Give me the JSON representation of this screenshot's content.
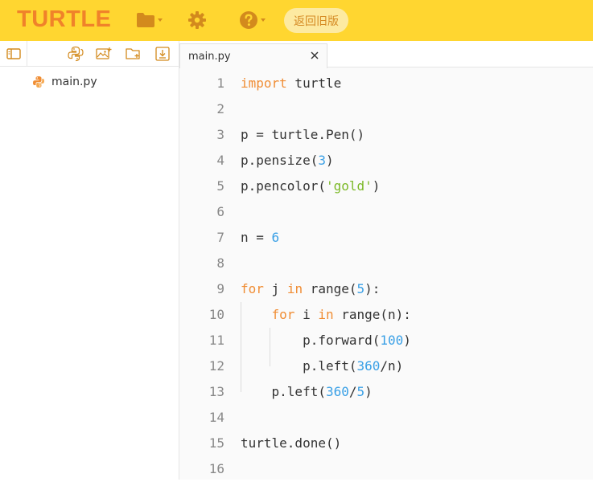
{
  "header": {
    "brand": "TURTLE",
    "old_version_label": "返回旧版"
  },
  "colors": {
    "topbar": "#ffd630",
    "brand": "#f0822a",
    "icon": "#d38a1d",
    "keyword": "#f08d34",
    "number": "#3aa0e6",
    "string": "#7cb928"
  },
  "sidebar": {
    "files": [
      {
        "name": "main.py",
        "icon": "python-file-icon"
      }
    ]
  },
  "editor": {
    "tab": {
      "label": "main.py"
    },
    "lines": [
      {
        "n": "1",
        "t": [
          [
            "kw",
            "import"
          ],
          [
            "p",
            " turtle"
          ]
        ]
      },
      {
        "n": "2",
        "t": []
      },
      {
        "n": "3",
        "t": [
          [
            "p",
            "p = turtle.Pen()"
          ]
        ]
      },
      {
        "n": "4",
        "t": [
          [
            "p",
            "p.pensize("
          ],
          [
            "num",
            "3"
          ],
          [
            "p",
            ")"
          ]
        ]
      },
      {
        "n": "5",
        "t": [
          [
            "p",
            "p.pencolor("
          ],
          [
            "str",
            "'gold'"
          ],
          [
            "p",
            ")"
          ]
        ]
      },
      {
        "n": "6",
        "t": []
      },
      {
        "n": "7",
        "t": [
          [
            "p",
            "n = "
          ],
          [
            "num",
            "6"
          ]
        ]
      },
      {
        "n": "8",
        "t": []
      },
      {
        "n": "9",
        "t": [
          [
            "kw",
            "for"
          ],
          [
            "p",
            " j "
          ],
          [
            "kw",
            "in"
          ],
          [
            "p",
            " range("
          ],
          [
            "num",
            "5"
          ],
          [
            "p",
            "):"
          ]
        ]
      },
      {
        "n": "10",
        "t": [
          [
            "p",
            "    "
          ],
          [
            "kw",
            "for"
          ],
          [
            "p",
            " i "
          ],
          [
            "kw",
            "in"
          ],
          [
            "p",
            " range(n):"
          ]
        ]
      },
      {
        "n": "11",
        "t": [
          [
            "p",
            "        p.forward("
          ],
          [
            "num",
            "100"
          ],
          [
            "p",
            ")"
          ]
        ]
      },
      {
        "n": "12",
        "t": [
          [
            "p",
            "        p.left("
          ],
          [
            "num",
            "360"
          ],
          [
            "p",
            "/n)"
          ]
        ]
      },
      {
        "n": "13",
        "t": [
          [
            "p",
            "    p.left("
          ],
          [
            "num",
            "360"
          ],
          [
            "p",
            "/"
          ],
          [
            "num",
            "5"
          ],
          [
            "p",
            ")"
          ]
        ]
      },
      {
        "n": "14",
        "t": []
      },
      {
        "n": "15",
        "t": [
          [
            "p",
            "turtle.done()"
          ]
        ]
      },
      {
        "n": "16",
        "t": []
      }
    ]
  }
}
